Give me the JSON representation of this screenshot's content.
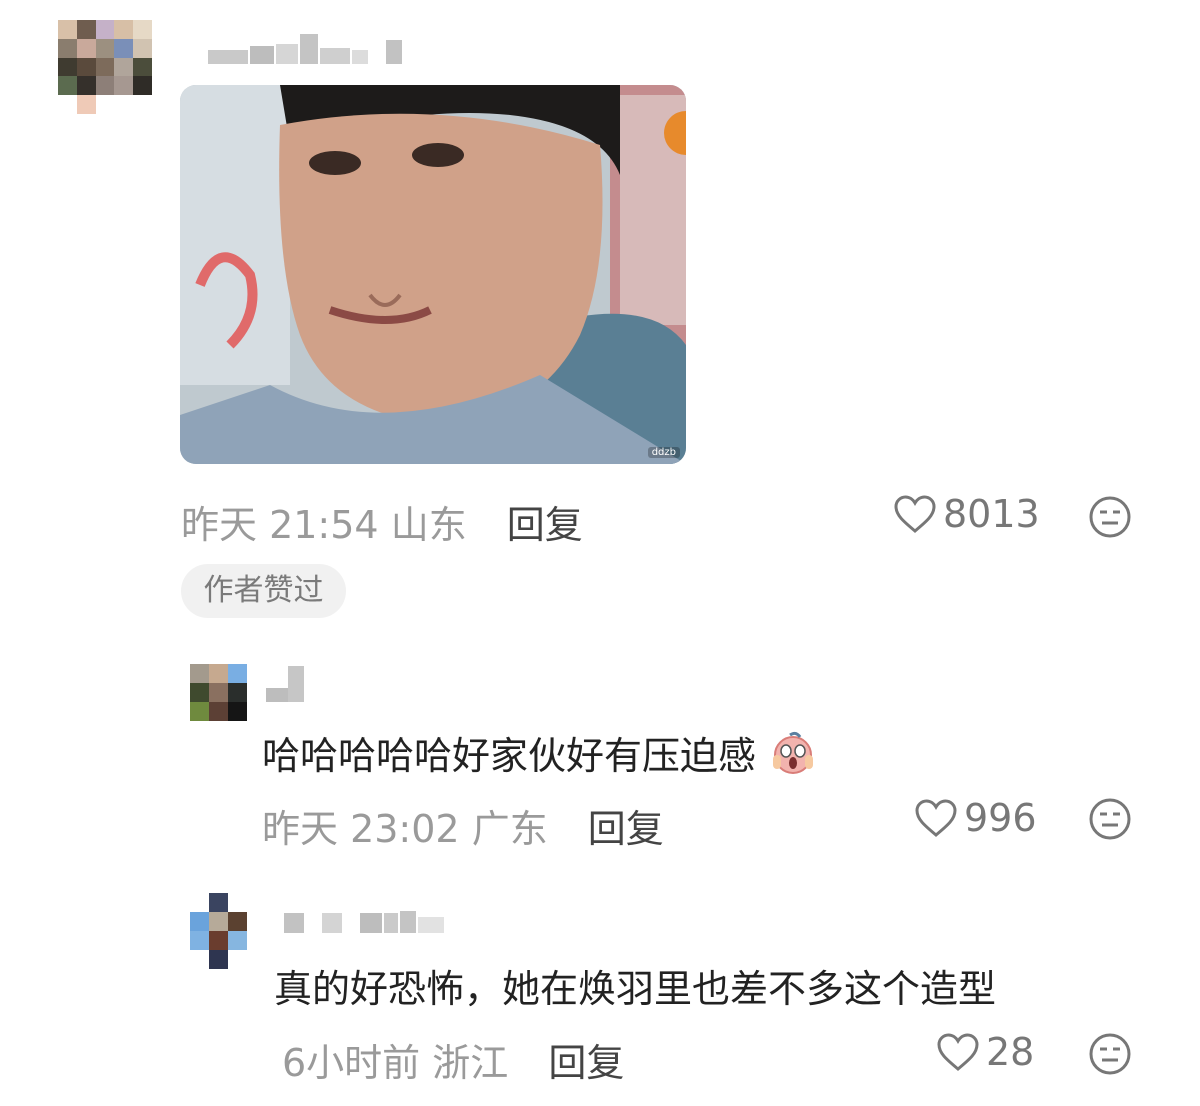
{
  "comment": {
    "attachment": {
      "watermark": "ddzb"
    },
    "time": "昨天 21:54",
    "location": "山东",
    "reply_label": "回复",
    "likes": "8013",
    "author_tag": "作者赞过"
  },
  "replies": [
    {
      "text": "哈哈哈哈哈好家伙好有压迫感",
      "time": "昨天 23:02",
      "location": "广东",
      "reply_label": "回复",
      "likes": "996"
    },
    {
      "text": "真的好恐怖，她在焕羽里也差不多这个造型",
      "time": "6小时前",
      "location": "浙江",
      "reply_label": "回复",
      "likes": "28"
    }
  ],
  "colors": {
    "meta_gray": "#9a9a9a",
    "text": "#222222",
    "tag_bg": "#f1f1f1"
  },
  "icons": [
    "heart-outline-icon",
    "emoji-face-icon",
    "scream-emoji-icon"
  ]
}
